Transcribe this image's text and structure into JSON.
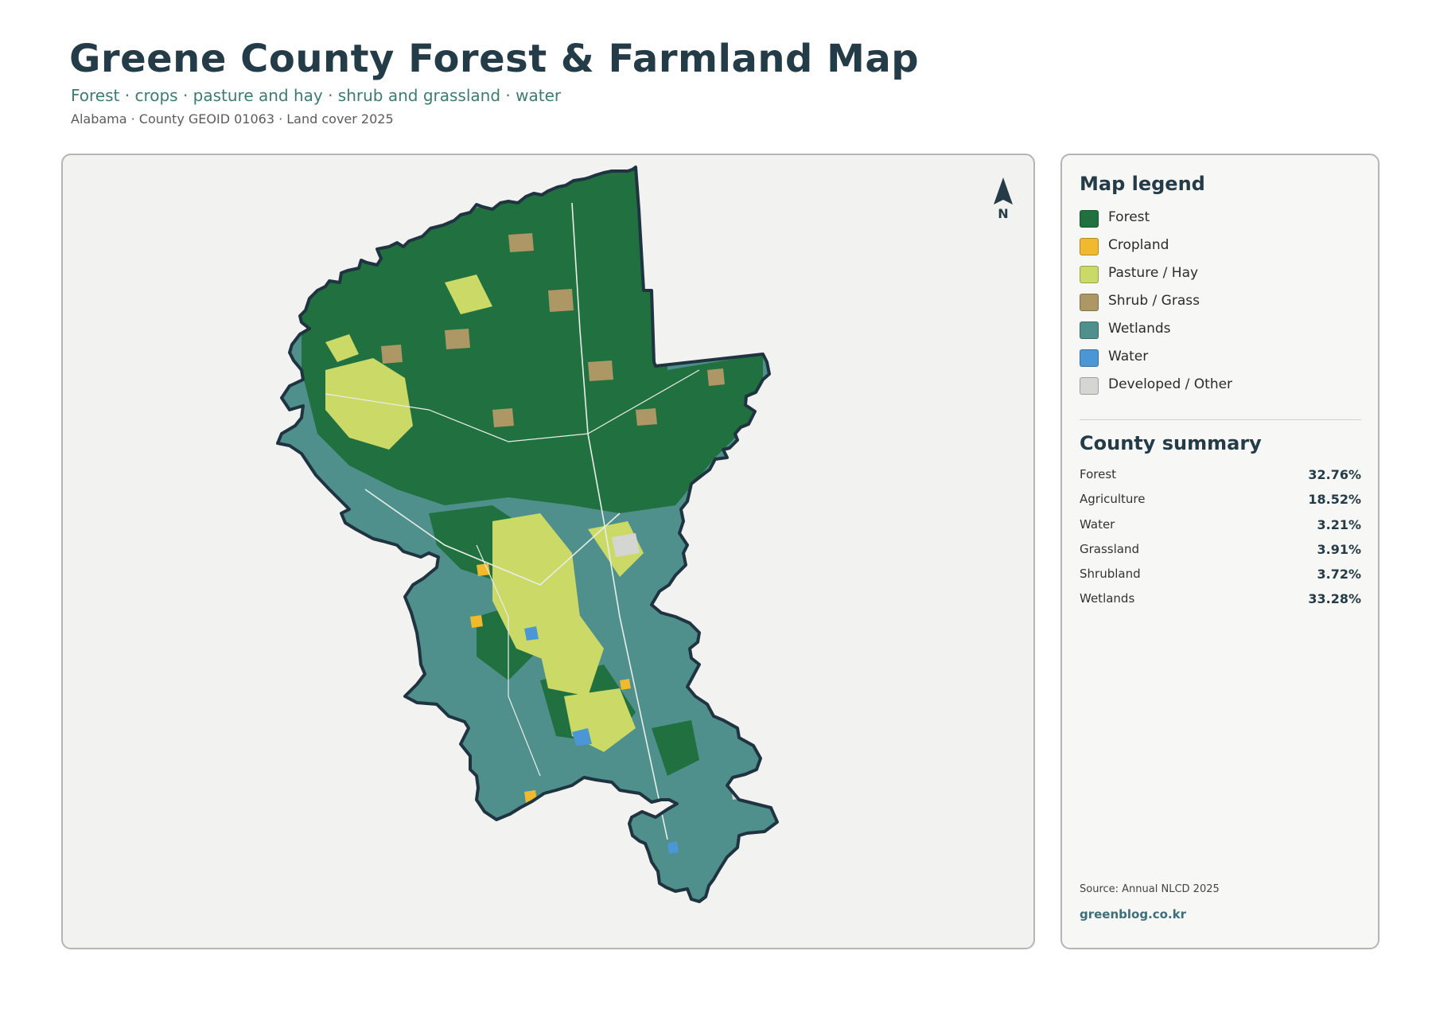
{
  "header": {
    "title": "Greene County Forest & Farmland Map",
    "subtitle": "Forest · crops · pasture and hay · shrub and grassland · water",
    "meta": "Alabama · County GEOID 01063 · Land cover 2025"
  },
  "map": {
    "north_label": "N",
    "base_color": "#4f8f8c",
    "outline_color": "#1f3440"
  },
  "legend": {
    "title": "Map legend",
    "items": [
      {
        "label": "Forest",
        "color": "#21703f"
      },
      {
        "label": "Cropland",
        "color": "#f0b92e"
      },
      {
        "label": "Pasture / Hay",
        "color": "#cbd967"
      },
      {
        "label": "Shrub / Grass",
        "color": "#ac9765"
      },
      {
        "label": "Wetlands",
        "color": "#4f8f8c"
      },
      {
        "label": "Water",
        "color": "#4b97d6"
      },
      {
        "label": "Developed / Other",
        "color": "#d5d5d2"
      }
    ]
  },
  "summary": {
    "title": "County summary",
    "rows": [
      {
        "label": "Forest",
        "value": "32.76%"
      },
      {
        "label": "Agriculture",
        "value": "18.52%"
      },
      {
        "label": "Water",
        "value": "3.21%"
      },
      {
        "label": "Grassland",
        "value": "3.91%"
      },
      {
        "label": "Shrubland",
        "value": "3.72%"
      },
      {
        "label": "Wetlands",
        "value": "33.28%"
      }
    ]
  },
  "footer": {
    "source": "Source: Annual NLCD 2025",
    "credit": "greenblog.co.kr"
  }
}
